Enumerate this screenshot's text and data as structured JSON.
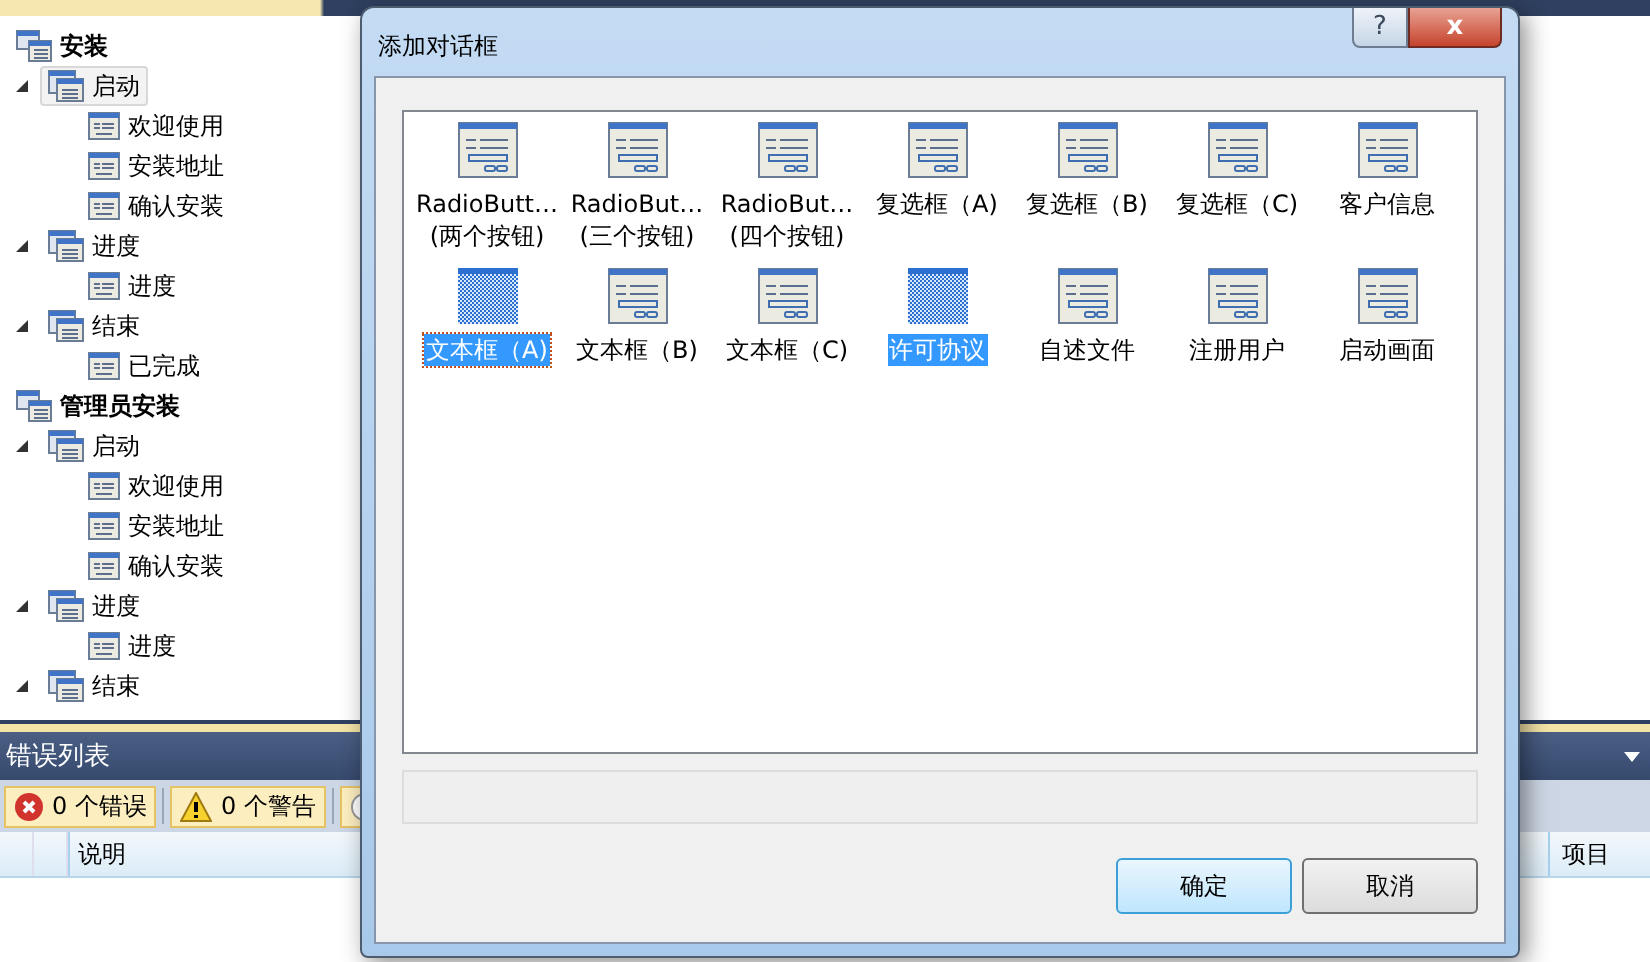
{
  "tree": [
    {
      "label": "安装",
      "kind": "root",
      "selected": false,
      "children": [
        {
          "label": "启动",
          "kind": "group",
          "expanded": true,
          "selected": true,
          "children": [
            {
              "label": "欢迎使用",
              "kind": "page",
              "selected": false
            },
            {
              "label": "安装地址",
              "kind": "page",
              "selected": false
            },
            {
              "label": "确认安装",
              "kind": "page",
              "selected": false
            }
          ]
        },
        {
          "label": "进度",
          "kind": "group",
          "expanded": true,
          "selected": false,
          "children": [
            {
              "label": "进度",
              "kind": "page",
              "selected": false
            }
          ]
        },
        {
          "label": "结束",
          "kind": "group",
          "expanded": true,
          "selected": false,
          "children": [
            {
              "label": "已完成",
              "kind": "page",
              "selected": false
            }
          ]
        }
      ]
    },
    {
      "label": "管理员安装",
      "kind": "root",
      "selected": false,
      "children": [
        {
          "label": "启动",
          "kind": "group",
          "expanded": true,
          "selected": false,
          "children": [
            {
              "label": "欢迎使用",
              "kind": "page",
              "selected": false
            },
            {
              "label": "安装地址",
              "kind": "page",
              "selected": false
            },
            {
              "label": "确认安装",
              "kind": "page",
              "selected": false
            }
          ]
        },
        {
          "label": "进度",
          "kind": "group",
          "expanded": true,
          "selected": false,
          "children": [
            {
              "label": "进度",
              "kind": "page",
              "selected": false
            }
          ]
        },
        {
          "label": "结束",
          "kind": "group",
          "expanded": true,
          "selected": false
        }
      ]
    }
  ],
  "error_list": {
    "title": "错误列表",
    "filters": [
      {
        "kind": "error",
        "label": "0 个错误"
      },
      {
        "kind": "warning",
        "label": "0 个警告"
      },
      {
        "kind": "message"
      }
    ],
    "columns": [
      {
        "label": "说明"
      },
      {
        "label": "项目"
      }
    ]
  },
  "dialog": {
    "title": "添加对话框",
    "help_button": "?",
    "close_button": "x",
    "items": [
      {
        "label": "RadioButt…\n(两个按钮)",
        "selected": false,
        "focused": false
      },
      {
        "label": "RadioBut…\n(三个按钮)",
        "selected": false,
        "focused": false
      },
      {
        "label": "RadioBut…\n(四个按钮)",
        "selected": false,
        "focused": false
      },
      {
        "label": "复选框（A)",
        "selected": false,
        "focused": false
      },
      {
        "label": "复选框（B)",
        "selected": false,
        "focused": false
      },
      {
        "label": "复选框（C)",
        "selected": false,
        "focused": false
      },
      {
        "label": "客户信息",
        "selected": false,
        "focused": false
      },
      {
        "label": "文本框（A)",
        "selected": true,
        "focused": true
      },
      {
        "label": "文本框（B)",
        "selected": false,
        "focused": false
      },
      {
        "label": "文本框（C)",
        "selected": false,
        "focused": false
      },
      {
        "label": "许可协议",
        "selected": true,
        "focused": false
      },
      {
        "label": "自述文件",
        "selected": false,
        "focused": false
      },
      {
        "label": "注册用户",
        "selected": false,
        "focused": false
      },
      {
        "label": "启动画面",
        "selected": false,
        "focused": false
      }
    ],
    "buttons": [
      {
        "label": "确定",
        "default": true
      },
      {
        "label": "取消",
        "default": false
      }
    ]
  }
}
